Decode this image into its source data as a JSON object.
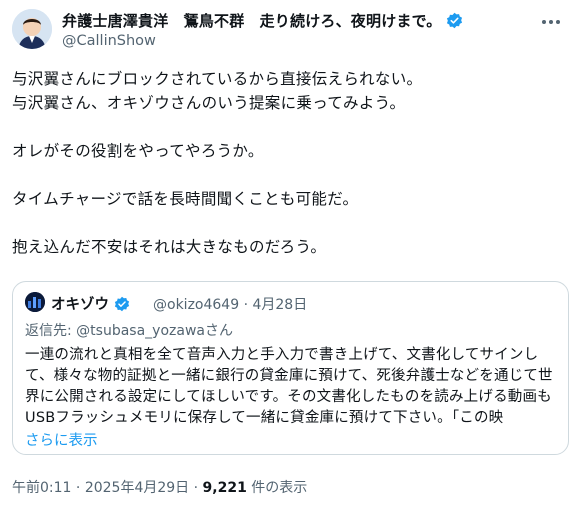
{
  "author": {
    "display_name": "弁護士唐澤貴洋　鵟鳥不群　走り続けろ、夜明けまで。",
    "handle": "@CallinShow"
  },
  "tweet_text": "与沢翼さんにブロックされているから直接伝えられない。\n与沢翼さん、オキゾウさんのいう提案に乗ってみよう。\n\nオレがその役割をやってやろうか。\n\nタイムチャージで話を長時間聞くことも可能だ。\n\n抱え込んだ不安はそれは大きなものだろう。",
  "quote": {
    "display_name": "オキゾウ",
    "handle": "@okizo4649",
    "separator": "·",
    "date": "4月28日",
    "reply_prefix": "返信先: ",
    "reply_to": "@tsubasa_yozawaさん",
    "text": "一連の流れと真相を全て音声入力と手入力で書き上げて、文書化してサインして、様々な物的証拠と一緒に銀行の貸金庫に預けて、死後弁護士などを通じて世界に公開される設定にしてほしいです。その文書化したものを読み上げる動画もUSBフラッシュメモリに保存して一緒に貸金庫に預けて下さい。「この映",
    "show_more": "さらに表示"
  },
  "footer": {
    "time": "午前0:11",
    "separator": "·",
    "date": "2025年4月29日",
    "views_count": "9,221",
    "views_label": " 件の表示"
  },
  "colors": {
    "verified": "#1d9bf0",
    "link": "#1d9bf0",
    "secondary_text": "#536471"
  },
  "icons": {
    "verified": "verified-badge-icon",
    "more": "more-dots-icon"
  }
}
